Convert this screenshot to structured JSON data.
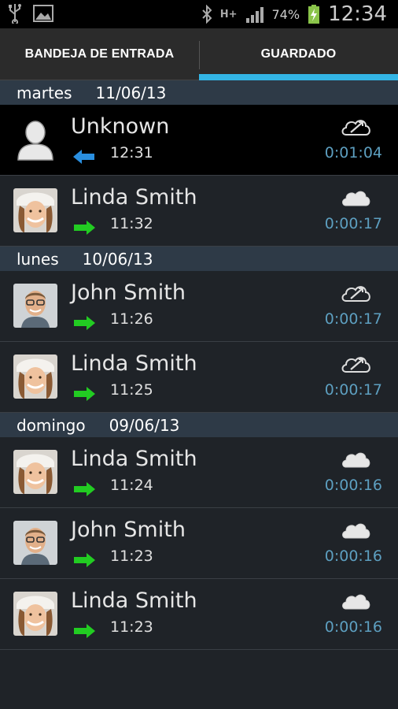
{
  "status_bar": {
    "battery_percent": "74%",
    "time": "12:34",
    "network": "H+"
  },
  "tabs": [
    {
      "label": "BANDEJA DE ENTRADA",
      "selected": false
    },
    {
      "label": "GUARDADO",
      "selected": true
    }
  ],
  "colors": {
    "accent": "#33b5e5",
    "incoming_arrow": "#2a8fe0",
    "outgoing_arrow": "#22cc22",
    "duration": "#5d9fc0",
    "section_bg": "#2e3a47"
  },
  "sections": [
    {
      "day": "martes",
      "date": "11/06/13",
      "calls": [
        {
          "name": "Unknown",
          "time": "12:31",
          "duration": "0:01:04",
          "direction": "incoming",
          "cloud": "cloud-sync-icon",
          "avatar": "unknown"
        },
        {
          "name": "Linda Smith",
          "time": "11:32",
          "duration": "0:00:17",
          "direction": "outgoing",
          "cloud": "cloud-icon",
          "avatar": "linda"
        }
      ]
    },
    {
      "day": "lunes",
      "date": "10/06/13",
      "calls": [
        {
          "name": "John Smith",
          "time": "11:26",
          "duration": "0:00:17",
          "direction": "outgoing",
          "cloud": "cloud-sync-icon",
          "avatar": "john"
        },
        {
          "name": "Linda Smith",
          "time": "11:25",
          "duration": "0:00:17",
          "direction": "outgoing",
          "cloud": "cloud-sync-icon",
          "avatar": "linda"
        }
      ]
    },
    {
      "day": "domingo",
      "date": "09/06/13",
      "calls": [
        {
          "name": "Linda Smith",
          "time": "11:24",
          "duration": "0:00:16",
          "direction": "outgoing",
          "cloud": "cloud-icon",
          "avatar": "linda"
        },
        {
          "name": "John Smith",
          "time": "11:23",
          "duration": "0:00:16",
          "direction": "outgoing",
          "cloud": "cloud-icon",
          "avatar": "john"
        },
        {
          "name": "Linda Smith",
          "time": "11:23",
          "duration": "0:00:16",
          "direction": "outgoing",
          "cloud": "cloud-icon",
          "avatar": "linda"
        }
      ]
    }
  ]
}
